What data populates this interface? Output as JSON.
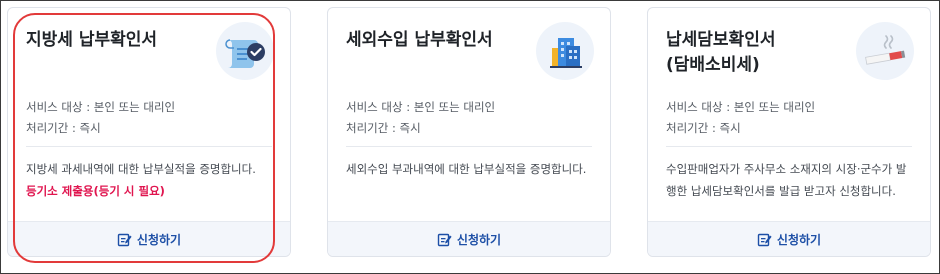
{
  "cards": [
    {
      "title": "지방세 납부확인서",
      "meta_target": "서비스 대상 : 본인 또는 대리인",
      "meta_period": "처리기간 : 즉시",
      "description": "지방세 과세내역에 대한 납부실적을 증명합니다.",
      "note": "등기소 제출용(등기 시 필요)",
      "apply_label": "신청하기",
      "icon": "document-scroll-check-icon"
    },
    {
      "title": "세외수입 납부확인서",
      "meta_target": "서비스 대상 : 본인 또는 대리인",
      "meta_period": "처리기간 : 즉시",
      "description": "세외수입 부과내역에 대한 납부실적을 증명합니다.",
      "apply_label": "신청하기",
      "icon": "building-icon"
    },
    {
      "title": "납세담보확인서\n(담배소비세)",
      "meta_target": "서비스 대상 : 본인 또는 대리인",
      "meta_period": "처리기간 : 즉시",
      "description": "수입판매업자가 주사무소 소재지의 시장·군수가 발행한 납세담보확인서를 발급 받고자 신청합니다.",
      "apply_label": "신청하기",
      "icon": "cigarette-icon"
    }
  ],
  "colors": {
    "accent": "#1d4fa6",
    "note": "#e0154f",
    "highlight": "#e23a3a",
    "card_footer": "#f3f6fb"
  }
}
